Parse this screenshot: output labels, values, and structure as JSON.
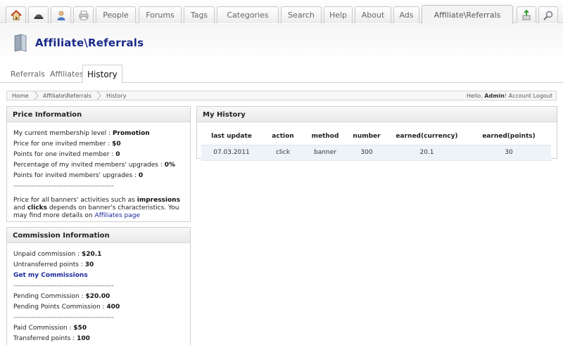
{
  "top_tabs": {
    "icons": [
      "home-icon",
      "hat-icon",
      "user-icon",
      "printer-icon"
    ],
    "labels": [
      "People",
      "Forums",
      "Tags",
      "Categories",
      "Search",
      "Help",
      "About",
      "Ads"
    ],
    "active": "Affiliate\\Referrals",
    "right_icons": [
      "add-page-icon",
      "search-icon"
    ]
  },
  "header": {
    "title": "Affiliate\\Referrals"
  },
  "sub_tabs": {
    "items": [
      "Referrals",
      "Affiliates"
    ],
    "active": "History"
  },
  "breadcrumb": {
    "items": [
      "Home",
      "Affiliate\\Referrals",
      "History"
    ],
    "greeting_prefix": "Hello,",
    "user": "Admin",
    "greeting_suffix": "!",
    "account": "Account",
    "logout": "Logout"
  },
  "price_panel": {
    "title": "Price Information",
    "rows": [
      {
        "label": "My current membership level :",
        "value": "Promotion"
      },
      {
        "label": "Price for one invited member :",
        "value": "$0"
      },
      {
        "label": "Points for one invited member :",
        "value": "0"
      },
      {
        "label": "Percentage of my invited members' upgrades :",
        "value": "0%"
      },
      {
        "label": "Points for invited members' upgrades :",
        "value": "0"
      }
    ],
    "separator": "--------------------------------------------",
    "note": {
      "p1": "Price for all banners' activities such as",
      "impressions": "impressions",
      "and": "and",
      "clicks": "clicks",
      "p2": "depends on banner's characteristics. You may find more details on",
      "link": "Affiliates page"
    }
  },
  "commission_panel": {
    "title": "Commission Information",
    "rows1": [
      {
        "label": "Unpaid commission :",
        "value": "$20.1"
      },
      {
        "label": "Untransferred points :",
        "value": "30"
      }
    ],
    "get_link": "Get my Commissions",
    "separator": "--------------------------------------------",
    "rows2": [
      {
        "label": "Pending Commission :",
        "value": "$20.00"
      },
      {
        "label": "Pending Points Commission :",
        "value": "400"
      }
    ],
    "rows3": [
      {
        "label": "Paid Commission :",
        "value": "$50"
      },
      {
        "label": "Transferred points :",
        "value": "100"
      }
    ]
  },
  "history_panel": {
    "title": "My History",
    "columns": [
      "last update",
      "action",
      "method",
      "number",
      "earned(currency)",
      "earned(points)"
    ],
    "rows": [
      [
        "07.03.2011",
        "click",
        "banner",
        "300",
        "20.1",
        "30"
      ]
    ]
  }
}
